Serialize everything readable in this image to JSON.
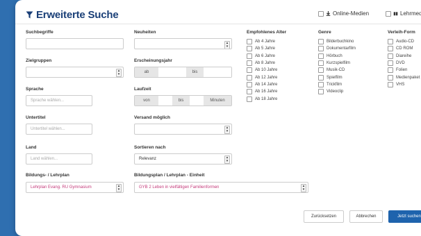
{
  "title": "Erweiterte Suche",
  "header_options": [
    {
      "label": "Online-Medien",
      "icon": "download-icon"
    },
    {
      "label": "Lehrmedien",
      "icon": "book-icon"
    }
  ],
  "fields": {
    "suchbegriffe": {
      "label": "Suchbegriffe",
      "value": ""
    },
    "zielgruppen": {
      "label": "Zielgruppen",
      "value": ""
    },
    "sprache": {
      "label": "Sprache",
      "placeholder": "Sprache wählen..."
    },
    "untertitel": {
      "label": "Untertitel",
      "placeholder": "Untertitel wählen..."
    },
    "land": {
      "label": "Land",
      "placeholder": "Land wählen..."
    },
    "bildungsplan": {
      "label": "Bildungs- / Lehrplan",
      "value": "Lehrplan Evang. RU Gymnasium"
    },
    "neuheiten": {
      "label": "Neuheiten",
      "value": ""
    },
    "erscheinungsjahr": {
      "label": "Erscheinungsjahr",
      "from_label": "ab",
      "to_label": "bis"
    },
    "laufzeit": {
      "label": "Laufzeit",
      "from_label": "von",
      "to_label": "bis",
      "unit": "Minuten"
    },
    "versand": {
      "label": "Versand möglich",
      "value": ""
    },
    "sortieren": {
      "label": "Sortieren nach",
      "value": "Relevanz"
    },
    "einheit": {
      "label": "Bildungsplan / Lehrplan - Einheit",
      "value": "GYB 2 Leben in vielfältigen Familienformen"
    }
  },
  "alter": {
    "title": "Empfohlenes Alter",
    "items": [
      "Ab 4 Jahre",
      "Ab 5 Jahre",
      "Ab 6 Jahre",
      "Ab 8 Jahre",
      "Ab 10 Jahre",
      "Ab 12 Jahre",
      "Ab 14 Jahre",
      "Ab 16 Jahre",
      "Ab 18 Jahre"
    ]
  },
  "genre": {
    "title": "Genre",
    "items": [
      "Bilderbuchkino",
      "Dokumentarfilm",
      "Hörbuch",
      "Kurzspielfilm",
      "Musik-CD",
      "Spielfilm",
      "Trickfilm",
      "Videoclip"
    ]
  },
  "verleih": {
    "title": "Verleih-Form",
    "items": [
      "Audio-CD",
      "CD ROM",
      "Diareihe",
      "DVD",
      "Folien",
      "Medienpaket",
      "VHS"
    ]
  },
  "buttons": {
    "reset": "Zurücksetzen",
    "cancel": "Abbrechen",
    "search": "Jetzt suchen"
  },
  "colors": {
    "accent": "#1e63ad",
    "title": "#1a3f77",
    "highlight_text": "#c43a7a",
    "background": "#2f6fb0"
  }
}
